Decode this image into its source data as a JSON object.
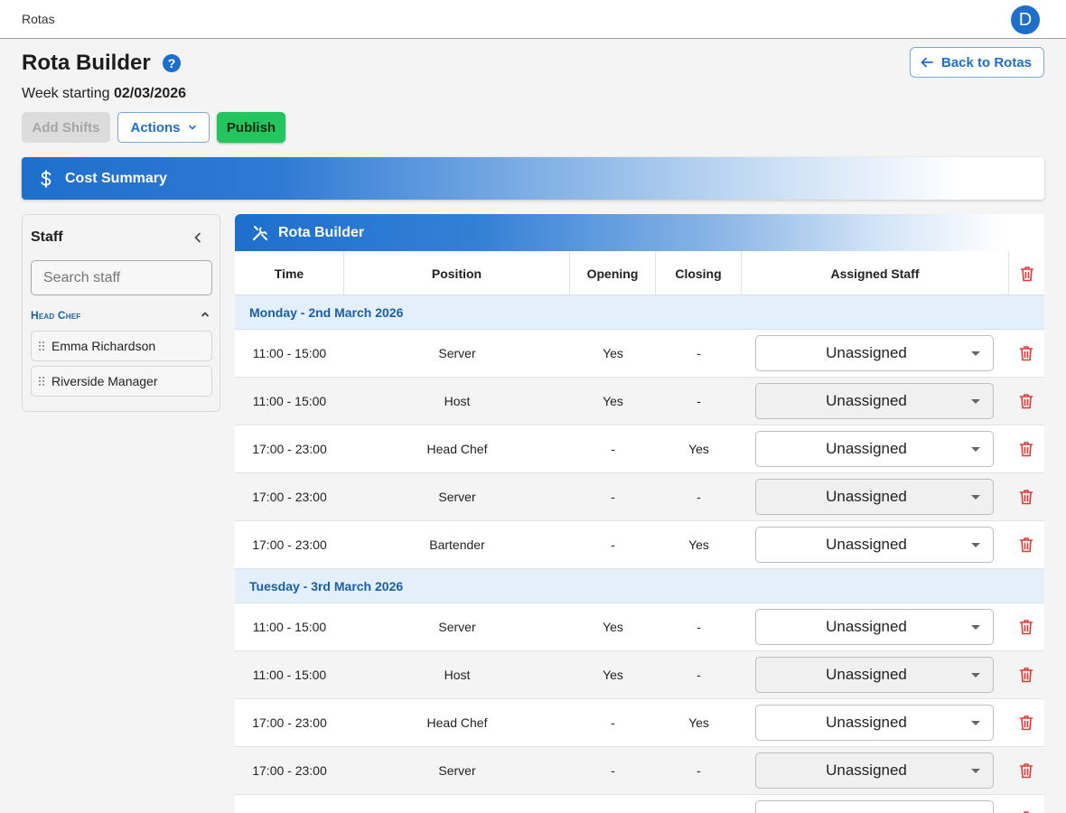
{
  "topbar": {
    "crumb": "Rotas",
    "avatar_letter": "D"
  },
  "header": {
    "title": "Rota Builder",
    "help": "?",
    "week_label": "Week starting",
    "week_date": "02/03/2026",
    "back_label": "Back to Rotas"
  },
  "toolbar": {
    "add_label": "Add Shifts",
    "actions_label": "Actions",
    "publish_label": "Publish"
  },
  "cost_summary": {
    "label": "Cost Summary"
  },
  "staff": {
    "title": "Staff",
    "search_placeholder": "Search staff",
    "group": "Head Chef",
    "members": [
      "Emma Richardson",
      "Riverside Manager"
    ]
  },
  "rota": {
    "title": "Rota Builder",
    "columns": {
      "time": "Time",
      "position": "Position",
      "opening": "Opening",
      "closing": "Closing",
      "assigned": "Assigned Staff"
    },
    "days": [
      {
        "label": "Monday - 2nd March 2026",
        "shifts": [
          {
            "time": "11:00 - 15:00",
            "position": "Server",
            "opening": "Yes",
            "closing": "-",
            "assigned": "Unassigned"
          },
          {
            "time": "11:00 - 15:00",
            "position": "Host",
            "opening": "Yes",
            "closing": "-",
            "assigned": "Unassigned"
          },
          {
            "time": "17:00 - 23:00",
            "position": "Head Chef",
            "opening": "-",
            "closing": "Yes",
            "assigned": "Unassigned"
          },
          {
            "time": "17:00 - 23:00",
            "position": "Server",
            "opening": "-",
            "closing": "-",
            "assigned": "Unassigned"
          },
          {
            "time": "17:00 - 23:00",
            "position": "Bartender",
            "opening": "-",
            "closing": "Yes",
            "assigned": "Unassigned"
          }
        ]
      },
      {
        "label": "Tuesday - 3rd March 2026",
        "shifts": [
          {
            "time": "11:00 - 15:00",
            "position": "Server",
            "opening": "Yes",
            "closing": "-",
            "assigned": "Unassigned"
          },
          {
            "time": "11:00 - 15:00",
            "position": "Host",
            "opening": "Yes",
            "closing": "-",
            "assigned": "Unassigned"
          },
          {
            "time": "17:00 - 23:00",
            "position": "Head Chef",
            "opening": "-",
            "closing": "Yes",
            "assigned": "Unassigned"
          },
          {
            "time": "17:00 - 23:00",
            "position": "Server",
            "opening": "-",
            "closing": "-",
            "assigned": "Unassigned"
          },
          {
            "time": "",
            "position": "",
            "opening": "",
            "closing": "",
            "assigned": ""
          }
        ]
      }
    ]
  },
  "colors": {
    "accent": "#1e6fcc",
    "publish": "#22c55e",
    "danger": "#e53935",
    "day_bg": "#e3f0fc"
  }
}
